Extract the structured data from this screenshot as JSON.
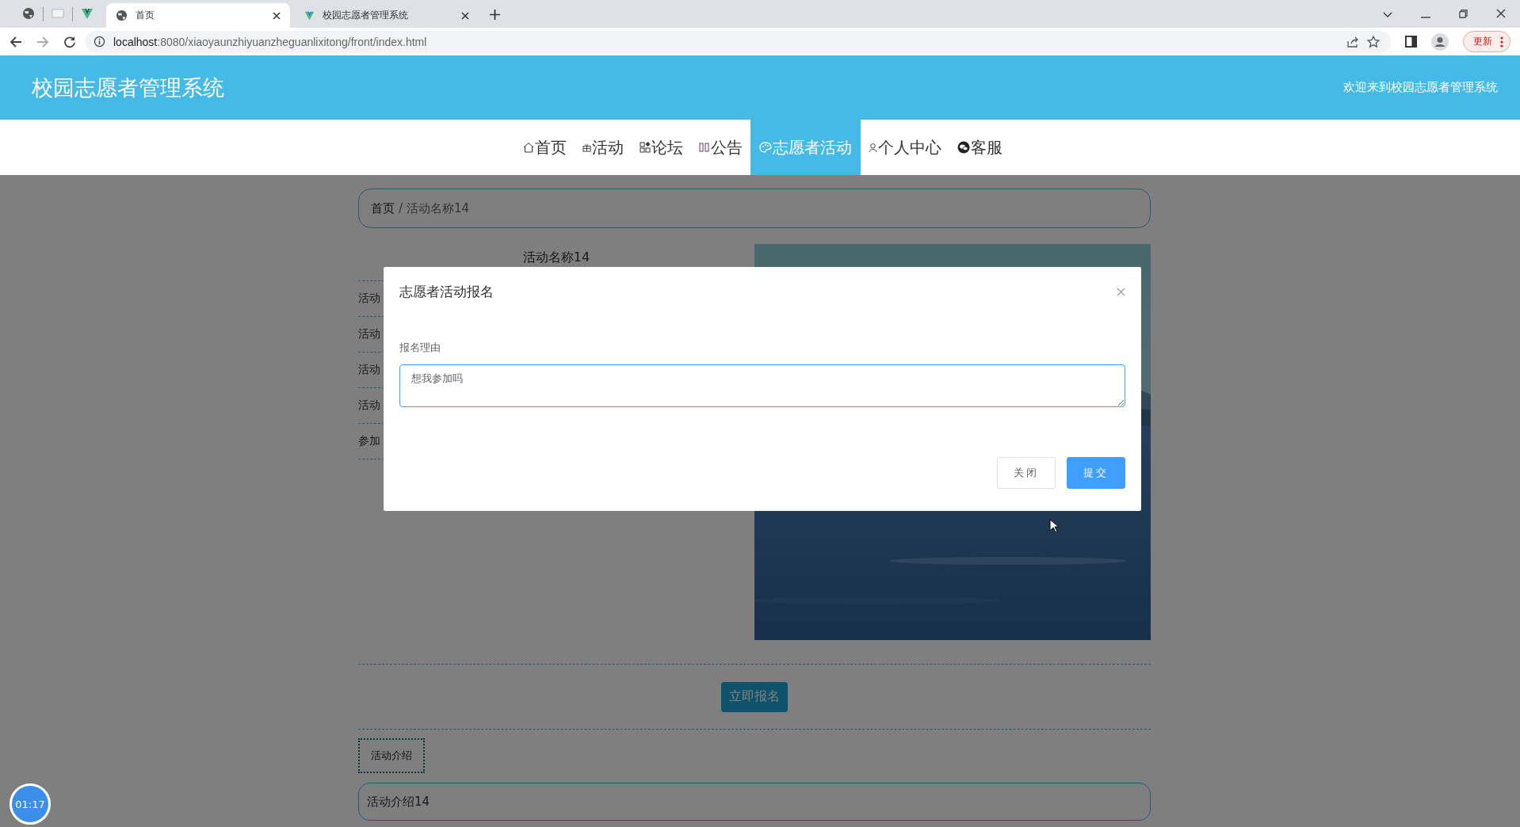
{
  "browser": {
    "tabs": [
      {
        "title": "首页",
        "selected": true
      },
      {
        "title": "校园志愿者管理系统",
        "selected": false
      }
    ],
    "host": "localhost",
    "path": ":8080/xiaoyaunzhiyuanzheguanlixitong/front/index.html",
    "update_button": "更新"
  },
  "header": {
    "title": "校园志愿者管理系统",
    "welcome": "欢迎来到校园志愿者管理系统"
  },
  "nav": [
    {
      "label": "首页",
      "kind": "home",
      "selected": false
    },
    {
      "label": "活动",
      "kind": "gift",
      "selected": false
    },
    {
      "label": "论坛",
      "kind": "grid",
      "selected": false
    },
    {
      "label": "公告",
      "kind": "bars",
      "selected": false
    },
    {
      "label": "志愿者活动",
      "kind": "palette",
      "selected": true
    },
    {
      "label": "个人中心",
      "kind": "user",
      "selected": false
    },
    {
      "label": "客服",
      "kind": "chat",
      "selected": false
    }
  ],
  "breadcrumb": {
    "home": "首页",
    "separator": "/",
    "current": "活动名称14"
  },
  "detail": {
    "title": "活动名称14",
    "rows": [
      "活动",
      "活动",
      "活动",
      "活动",
      "参加"
    ]
  },
  "signup_button": "立即报名",
  "section_tabs": [
    {
      "label": "活动介绍",
      "selected": true
    }
  ],
  "intro": "活动介绍14",
  "timer": "01:17",
  "modal": {
    "title": "志愿者活动报名",
    "field_label": "报名理由",
    "reason": "想我参加吗",
    "buttons": [
      {
        "label": "关闭",
        "kind": "default"
      },
      {
        "label": "提交",
        "kind": "primary"
      }
    ]
  }
}
